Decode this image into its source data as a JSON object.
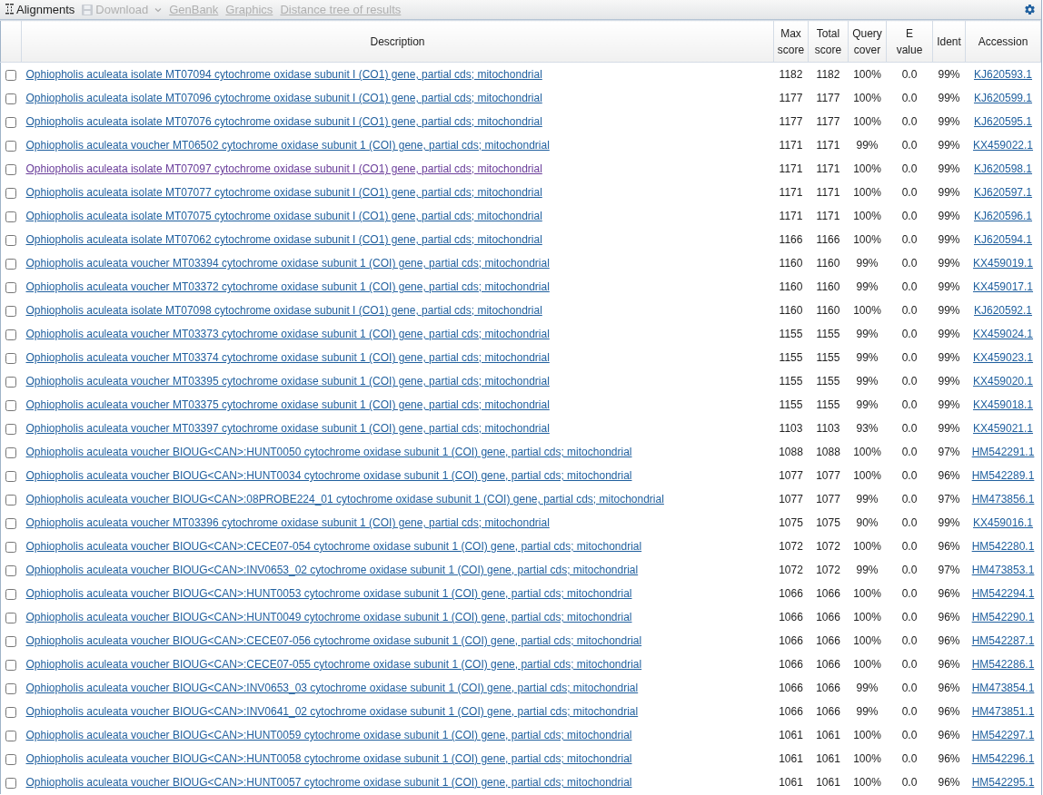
{
  "toolbar": {
    "tabs": [
      {
        "label": "Alignments",
        "disabled": false
      },
      {
        "label": "Download",
        "disabled": true
      }
    ],
    "links": [
      {
        "label": "GenBank",
        "disabled": true
      },
      {
        "label": "Graphics",
        "disabled": true
      },
      {
        "label": "Distance tree of results",
        "disabled": true
      }
    ]
  },
  "table": {
    "columns": [
      {
        "line1": "Description"
      },
      {
        "line1": "Max",
        "line2": "score"
      },
      {
        "line1": "Total",
        "line2": "score"
      },
      {
        "line1": "Query",
        "line2": "cover"
      },
      {
        "line1": "E",
        "line2": "value"
      },
      {
        "line1": "Ident"
      },
      {
        "line1": "Accession"
      }
    ],
    "rows": [
      {
        "checked": false,
        "visited": false,
        "description": "Ophiopholis aculeata isolate MT07094 cytochrome oxidase subunit I (CO1) gene, partial cds; mitochondrial",
        "max_score": "1182",
        "total_score": "1182",
        "query_cover": "100%",
        "e_value": "0.0",
        "ident": "99%",
        "accession": "KJ620593.1"
      },
      {
        "checked": false,
        "visited": false,
        "description": "Ophiopholis aculeata isolate MT07096 cytochrome oxidase subunit I (CO1) gene, partial cds; mitochondrial",
        "max_score": "1177",
        "total_score": "1177",
        "query_cover": "100%",
        "e_value": "0.0",
        "ident": "99%",
        "accession": "KJ620599.1"
      },
      {
        "checked": false,
        "visited": false,
        "description": "Ophiopholis aculeata isolate MT07076 cytochrome oxidase subunit I (CO1) gene, partial cds; mitochondrial",
        "max_score": "1177",
        "total_score": "1177",
        "query_cover": "100%",
        "e_value": "0.0",
        "ident": "99%",
        "accession": "KJ620595.1"
      },
      {
        "checked": false,
        "visited": false,
        "description": "Ophiopholis aculeata voucher MT06502 cytochrome oxidase subunit 1 (COI) gene, partial cds; mitochondrial",
        "max_score": "1171",
        "total_score": "1171",
        "query_cover": "99%",
        "e_value": "0.0",
        "ident": "99%",
        "accession": "KX459022.1"
      },
      {
        "checked": false,
        "visited": true,
        "description": "Ophiopholis aculeata isolate MT07097 cytochrome oxidase subunit I (CO1) gene, partial cds; mitochondrial",
        "max_score": "1171",
        "total_score": "1171",
        "query_cover": "100%",
        "e_value": "0.0",
        "ident": "99%",
        "accession": "KJ620598.1"
      },
      {
        "checked": false,
        "visited": false,
        "description": "Ophiopholis aculeata isolate MT07077 cytochrome oxidase subunit I (CO1) gene, partial cds; mitochondrial",
        "max_score": "1171",
        "total_score": "1171",
        "query_cover": "100%",
        "e_value": "0.0",
        "ident": "99%",
        "accession": "KJ620597.1"
      },
      {
        "checked": false,
        "visited": false,
        "description": "Ophiopholis aculeata isolate MT07075 cytochrome oxidase subunit I (CO1) gene, partial cds; mitochondrial",
        "max_score": "1171",
        "total_score": "1171",
        "query_cover": "100%",
        "e_value": "0.0",
        "ident": "99%",
        "accession": "KJ620596.1"
      },
      {
        "checked": false,
        "visited": false,
        "description": "Ophiopholis aculeata isolate MT07062 cytochrome oxidase subunit I (CO1) gene, partial cds; mitochondrial",
        "max_score": "1166",
        "total_score": "1166",
        "query_cover": "100%",
        "e_value": "0.0",
        "ident": "99%",
        "accession": "KJ620594.1"
      },
      {
        "checked": false,
        "visited": false,
        "description": "Ophiopholis aculeata voucher MT03394 cytochrome oxidase subunit 1 (COI) gene, partial cds; mitochondrial",
        "max_score": "1160",
        "total_score": "1160",
        "query_cover": "99%",
        "e_value": "0.0",
        "ident": "99%",
        "accession": "KX459019.1"
      },
      {
        "checked": false,
        "visited": false,
        "description": "Ophiopholis aculeata voucher MT03372 cytochrome oxidase subunit 1 (COI) gene, partial cds; mitochondrial",
        "max_score": "1160",
        "total_score": "1160",
        "query_cover": "99%",
        "e_value": "0.0",
        "ident": "99%",
        "accession": "KX459017.1"
      },
      {
        "checked": false,
        "visited": false,
        "description": "Ophiopholis aculeata isolate MT07098 cytochrome oxidase subunit I (CO1) gene, partial cds; mitochondrial",
        "max_score": "1160",
        "total_score": "1160",
        "query_cover": "100%",
        "e_value": "0.0",
        "ident": "99%",
        "accession": "KJ620592.1"
      },
      {
        "checked": false,
        "visited": false,
        "description": "Ophiopholis aculeata voucher MT03373 cytochrome oxidase subunit 1 (COI) gene, partial cds; mitochondrial",
        "max_score": "1155",
        "total_score": "1155",
        "query_cover": "99%",
        "e_value": "0.0",
        "ident": "99%",
        "accession": "KX459024.1"
      },
      {
        "checked": false,
        "visited": false,
        "description": "Ophiopholis aculeata voucher MT03374 cytochrome oxidase subunit 1 (COI) gene, partial cds; mitochondrial",
        "max_score": "1155",
        "total_score": "1155",
        "query_cover": "99%",
        "e_value": "0.0",
        "ident": "99%",
        "accession": "KX459023.1"
      },
      {
        "checked": false,
        "visited": false,
        "description": "Ophiopholis aculeata voucher MT03395 cytochrome oxidase subunit 1 (COI) gene, partial cds; mitochondrial",
        "max_score": "1155",
        "total_score": "1155",
        "query_cover": "99%",
        "e_value": "0.0",
        "ident": "99%",
        "accession": "KX459020.1"
      },
      {
        "checked": false,
        "visited": false,
        "description": "Ophiopholis aculeata voucher MT03375 cytochrome oxidase subunit 1 (COI) gene, partial cds; mitochondrial",
        "max_score": "1155",
        "total_score": "1155",
        "query_cover": "99%",
        "e_value": "0.0",
        "ident": "99%",
        "accession": "KX459018.1"
      },
      {
        "checked": false,
        "visited": false,
        "description": "Ophiopholis aculeata voucher MT03397 cytochrome oxidase subunit 1 (COI) gene, partial cds; mitochondrial",
        "max_score": "1103",
        "total_score": "1103",
        "query_cover": "93%",
        "e_value": "0.0",
        "ident": "99%",
        "accession": "KX459021.1"
      },
      {
        "checked": false,
        "visited": false,
        "description": "Ophiopholis aculeata voucher BIOUG<CAN>:HUNT0050 cytochrome oxidase subunit 1 (COI) gene, partial cds; mitochondrial",
        "max_score": "1088",
        "total_score": "1088",
        "query_cover": "100%",
        "e_value": "0.0",
        "ident": "97%",
        "accession": "HM542291.1"
      },
      {
        "checked": false,
        "visited": false,
        "description": "Ophiopholis aculeata voucher BIOUG<CAN>:HUNT0034 cytochrome oxidase subunit 1 (COI) gene, partial cds; mitochondrial",
        "max_score": "1077",
        "total_score": "1077",
        "query_cover": "100%",
        "e_value": "0.0",
        "ident": "96%",
        "accession": "HM542289.1"
      },
      {
        "checked": false,
        "visited": false,
        "description": "Ophiopholis aculeata voucher BIOUG<CAN>:08PROBE224_01 cytochrome oxidase subunit 1 (COI) gene, partial cds; mitochondrial",
        "max_score": "1077",
        "total_score": "1077",
        "query_cover": "99%",
        "e_value": "0.0",
        "ident": "97%",
        "accession": "HM473856.1"
      },
      {
        "checked": false,
        "visited": false,
        "description": "Ophiopholis aculeata voucher MT03396 cytochrome oxidase subunit 1 (COI) gene, partial cds; mitochondrial",
        "max_score": "1075",
        "total_score": "1075",
        "query_cover": "90%",
        "e_value": "0.0",
        "ident": "99%",
        "accession": "KX459016.1"
      },
      {
        "checked": false,
        "visited": false,
        "description": "Ophiopholis aculeata voucher BIOUG<CAN>:CECE07-054 cytochrome oxidase subunit 1 (COI) gene, partial cds; mitochondrial",
        "max_score": "1072",
        "total_score": "1072",
        "query_cover": "100%",
        "e_value": "0.0",
        "ident": "96%",
        "accession": "HM542280.1"
      },
      {
        "checked": false,
        "visited": false,
        "description": "Ophiopholis aculeata voucher BIOUG<CAN>:INV0653_02 cytochrome oxidase subunit 1 (COI) gene, partial cds; mitochondrial",
        "max_score": "1072",
        "total_score": "1072",
        "query_cover": "99%",
        "e_value": "0.0",
        "ident": "97%",
        "accession": "HM473853.1"
      },
      {
        "checked": false,
        "visited": false,
        "description": "Ophiopholis aculeata voucher BIOUG<CAN>:HUNT0053 cytochrome oxidase subunit 1 (COI) gene, partial cds; mitochondrial",
        "max_score": "1066",
        "total_score": "1066",
        "query_cover": "100%",
        "e_value": "0.0",
        "ident": "96%",
        "accession": "HM542294.1"
      },
      {
        "checked": false,
        "visited": false,
        "description": "Ophiopholis aculeata voucher BIOUG<CAN>:HUNT0049 cytochrome oxidase subunit 1 (COI) gene, partial cds; mitochondrial",
        "max_score": "1066",
        "total_score": "1066",
        "query_cover": "100%",
        "e_value": "0.0",
        "ident": "96%",
        "accession": "HM542290.1"
      },
      {
        "checked": false,
        "visited": false,
        "description": "Ophiopholis aculeata voucher BIOUG<CAN>:CECE07-056 cytochrome oxidase subunit 1 (COI) gene, partial cds; mitochondrial",
        "max_score": "1066",
        "total_score": "1066",
        "query_cover": "100%",
        "e_value": "0.0",
        "ident": "96%",
        "accession": "HM542287.1"
      },
      {
        "checked": false,
        "visited": false,
        "description": "Ophiopholis aculeata voucher BIOUG<CAN>:CECE07-055 cytochrome oxidase subunit 1 (COI) gene, partial cds; mitochondrial",
        "max_score": "1066",
        "total_score": "1066",
        "query_cover": "100%",
        "e_value": "0.0",
        "ident": "96%",
        "accession": "HM542286.1"
      },
      {
        "checked": false,
        "visited": false,
        "description": "Ophiopholis aculeata voucher BIOUG<CAN>:INV0653_03 cytochrome oxidase subunit 1 (COI) gene, partial cds; mitochondrial",
        "max_score": "1066",
        "total_score": "1066",
        "query_cover": "99%",
        "e_value": "0.0",
        "ident": "96%",
        "accession": "HM473854.1"
      },
      {
        "checked": false,
        "visited": false,
        "description": "Ophiopholis aculeata voucher BIOUG<CAN>:INV0641_02 cytochrome oxidase subunit 1 (COI) gene, partial cds; mitochondrial",
        "max_score": "1066",
        "total_score": "1066",
        "query_cover": "99%",
        "e_value": "0.0",
        "ident": "96%",
        "accession": "HM473851.1"
      },
      {
        "checked": false,
        "visited": false,
        "description": "Ophiopholis aculeata voucher BIOUG<CAN>:HUNT0059 cytochrome oxidase subunit 1 (COI) gene, partial cds; mitochondrial",
        "max_score": "1061",
        "total_score": "1061",
        "query_cover": "100%",
        "e_value": "0.0",
        "ident": "96%",
        "accession": "HM542297.1"
      },
      {
        "checked": false,
        "visited": false,
        "description": "Ophiopholis aculeata voucher BIOUG<CAN>:HUNT0058 cytochrome oxidase subunit 1 (COI) gene, partial cds; mitochondrial",
        "max_score": "1061",
        "total_score": "1061",
        "query_cover": "100%",
        "e_value": "0.0",
        "ident": "96%",
        "accession": "HM542296.1"
      },
      {
        "checked": false,
        "visited": false,
        "description": "Ophiopholis aculeata voucher BIOUG<CAN>:HUNT0057 cytochrome oxidase subunit 1 (COI) gene, partial cds; mitochondrial",
        "max_score": "1061",
        "total_score": "1061",
        "query_cover": "100%",
        "e_value": "0.0",
        "ident": "96%",
        "accession": "HM542295.1"
      }
    ]
  }
}
